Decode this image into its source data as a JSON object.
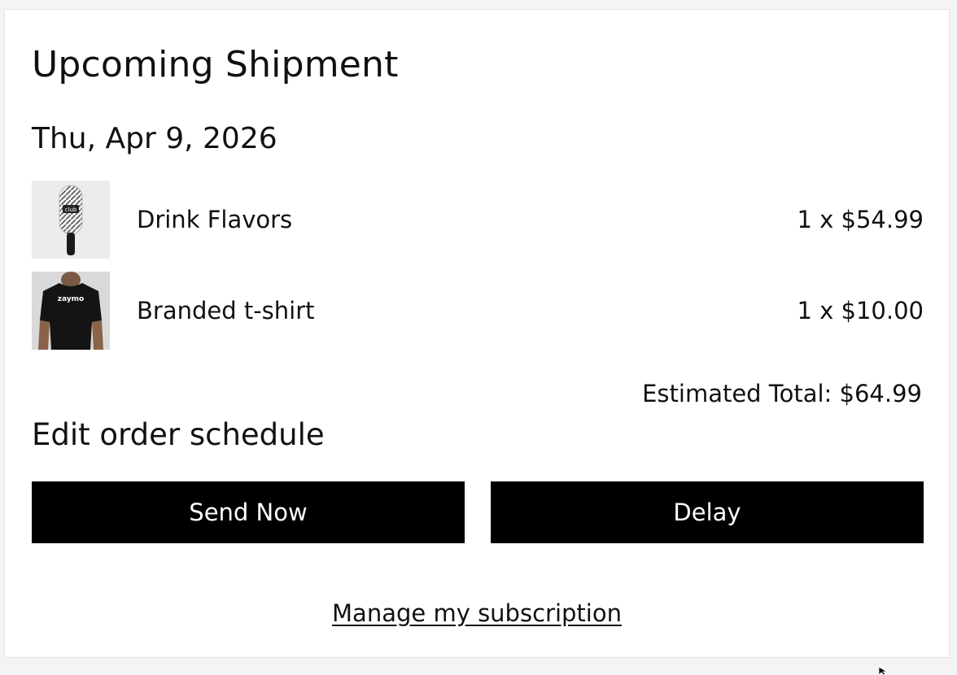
{
  "shipment": {
    "title": "Upcoming Shipment",
    "date": "Thu, Apr 9, 2026",
    "items": [
      {
        "name": "Drink Flavors",
        "price": "1 x $54.99",
        "thumbnail_icon": "pickleball-paddle-icon",
        "thumbnail_label": "club"
      },
      {
        "name": "Branded t-shirt",
        "price": "1 x $10.00",
        "thumbnail_icon": "tshirt-icon",
        "thumbnail_label": "zaymo"
      }
    ],
    "estimated_total": "Estimated Total: $64.99"
  },
  "schedule": {
    "heading": "Edit order schedule",
    "send_now_label": "Send Now",
    "delay_label": "Delay"
  },
  "footer": {
    "manage_link": "Manage my subscription"
  },
  "colors": {
    "button_bg": "#000000",
    "button_text": "#ffffff",
    "card_bg": "#ffffff",
    "page_bg": "#f4f4f4"
  }
}
